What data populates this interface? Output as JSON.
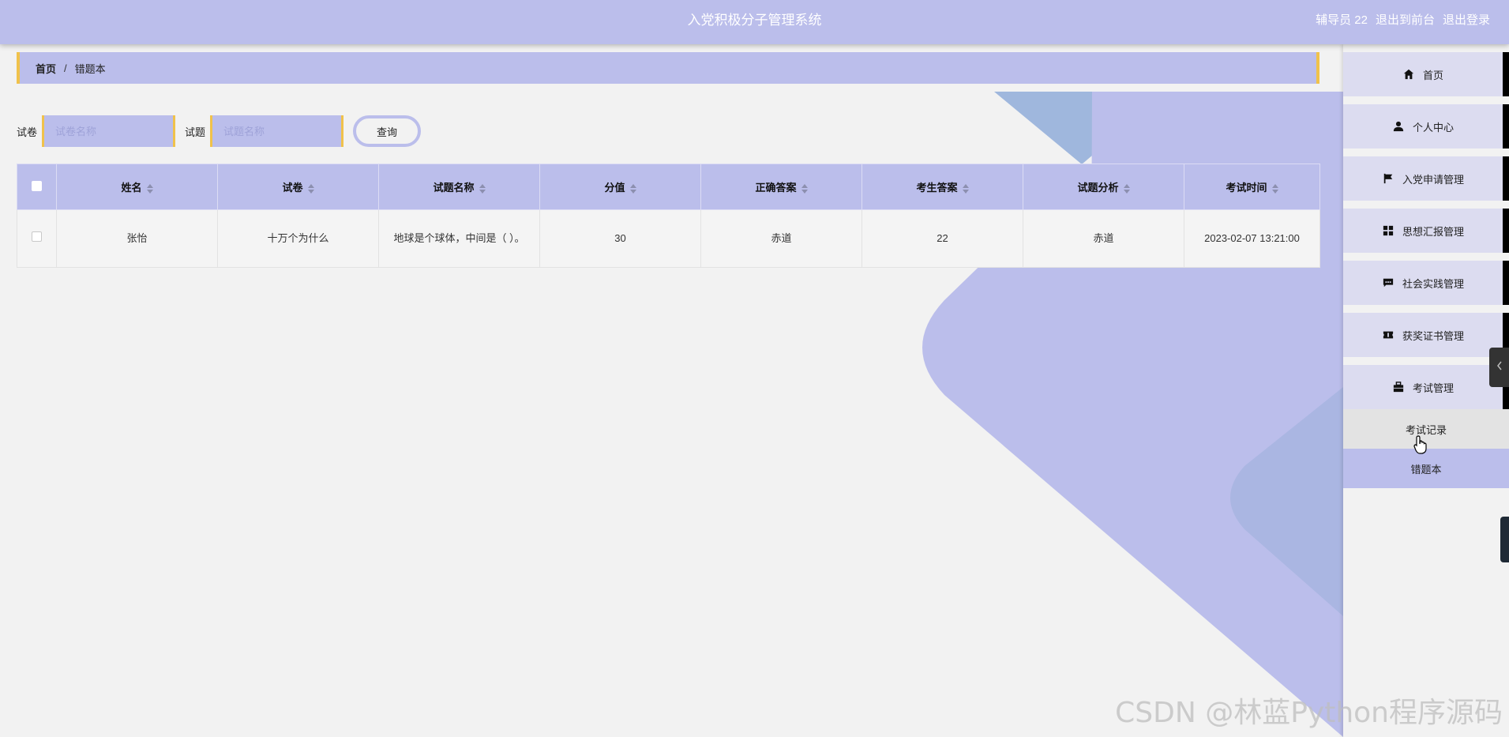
{
  "header": {
    "title": "入党积极分子管理系统",
    "user_label": "辅导员 22",
    "to_front_label": "退出到前台",
    "logout_label": "退出登录"
  },
  "breadcrumb": {
    "home": "首页",
    "separator": "/",
    "current": "错题本"
  },
  "search": {
    "paper_label": "试卷",
    "paper_placeholder": "试卷名称",
    "question_label": "试题",
    "question_placeholder": "试题名称",
    "query_button": "查询"
  },
  "table": {
    "columns": [
      "姓名",
      "试卷",
      "试题名称",
      "分值",
      "正确答案",
      "考生答案",
      "试题分析",
      "考试时间"
    ],
    "rows": [
      {
        "name": "张怡",
        "paper": "十万个为什么",
        "question": "地球是个球体，中间是（ ）。",
        "score": "30",
        "correct_answer": "赤道",
        "student_answer": "22",
        "analysis": "赤道",
        "exam_time": "2023-02-07 13:21:00"
      }
    ]
  },
  "sidebar": {
    "items": [
      {
        "label": "首页",
        "icon": "home-icon"
      },
      {
        "label": "个人中心",
        "icon": "person-icon"
      },
      {
        "label": "入党申请管理",
        "icon": "flag-icon"
      },
      {
        "label": "思想汇报管理",
        "icon": "grid-icon"
      },
      {
        "label": "社会实践管理",
        "icon": "chat-icon"
      },
      {
        "label": "获奖证书管理",
        "icon": "ticket-icon"
      },
      {
        "label": "考试管理",
        "icon": "briefcase-icon"
      }
    ],
    "sub_items": [
      {
        "label": "考试记录",
        "state": "hover"
      },
      {
        "label": "错题本",
        "state": "active"
      }
    ]
  },
  "watermark": "CSDN @林蓝Python程序源码",
  "colors": {
    "accent": "#bbbeeb",
    "border_accent": "#f0c24b",
    "background": "#f2f2f2"
  }
}
